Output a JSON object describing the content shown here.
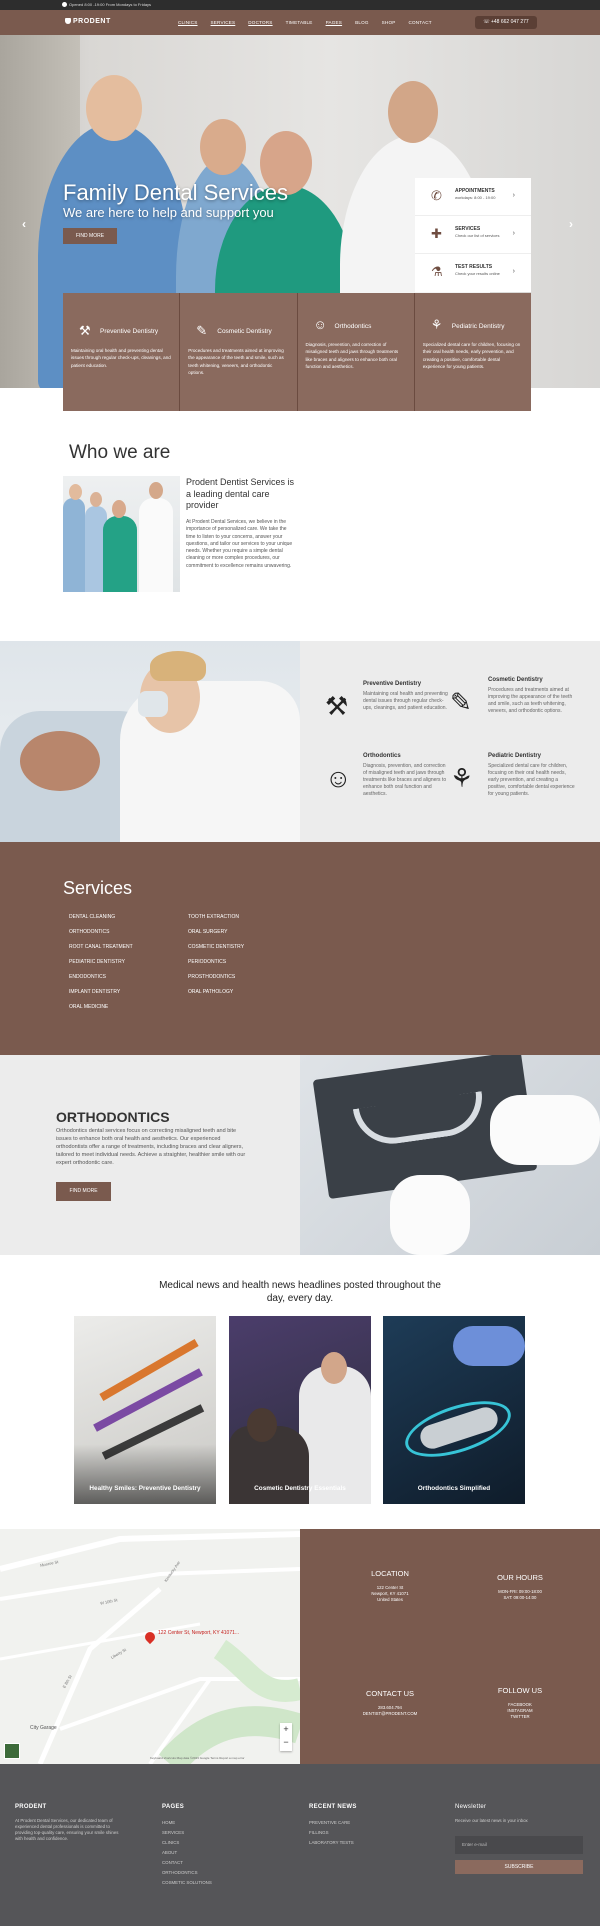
{
  "topbar": {
    "hours": "Opened 8:00 -19:00 From Mondays to Fridays"
  },
  "nav": {
    "logo": "PRODENT",
    "items": [
      "CLINICS",
      "SERVICES",
      "DOCTORS",
      "TIMETABLE",
      "PAGES",
      "BLOG",
      "SHOP",
      "CONTACT"
    ],
    "phone": "+48 662 047 277"
  },
  "hero": {
    "title": "Family Dental Services",
    "subtitle": "We are here to help and support you",
    "button": "FIND MORE"
  },
  "side": [
    {
      "title": "APPOINTMENTS",
      "sub": "workdays: 8:00 - 19:00",
      "icon": "phone-icon"
    },
    {
      "title": "SERVICES",
      "sub": "Check our list of services",
      "icon": "medkit-icon"
    },
    {
      "title": "TEST RESULTS",
      "sub": "Check your results online",
      "icon": "microscope-icon"
    }
  ],
  "cards": [
    {
      "title": "Preventive Dentistry",
      "desc": "Maintaining oral health and preventing dental issues through regular check-ups, cleanings, and patient education."
    },
    {
      "title": "Cosmetic Dentistry",
      "desc": "Procedures and treatments aimed at improving the appearance of the teeth and smile, such as teeth whitening, veneers, and orthodontic options."
    },
    {
      "title": "Orthodontics",
      "desc": "Diagnosis, prevention, and correction of misaligned teeth and jaws through treatments like braces and aligners to enhance both oral function and aesthetics."
    },
    {
      "title": "Pediatric Dentistry",
      "desc": "Specialized dental care for children, focusing on their oral health needs, early prevention, and creating a positive, comfortable dental experience for young patients."
    }
  ],
  "who": {
    "heading": "Who we are",
    "title": "Prodent Dentist Services is a leading dental care provider",
    "text": "At Prodent Dental Services, we believe in the importance of personalized care. We take the time to listen to your concerns, answer your questions, and tailor our services to your unique needs. Whether you require a simple dental cleaning or more complex procedures, our commitment to excellence remains unwavering."
  },
  "services": {
    "heading": "Services",
    "col1": [
      "DENTAL CLEANING",
      "ORTHODONTICS",
      "ROOT CANAL TREATMENT",
      "PEDIATRIC DENTISTRY",
      "ENDODONTICS",
      "IMPLANT DENTISTRY",
      "ORAL MEDICINE"
    ],
    "col2": [
      "TOOTH EXTRACTION",
      "ORAL SURGERY",
      "COSMETIC DENTISTRY",
      "PERIODONTICS",
      "PROSTHODONTICS",
      "ORAL PATHOLOGY"
    ]
  },
  "ortho": {
    "title": "ORTHODONTICS",
    "text": "Orthodontics dental services focus on correcting misaligned teeth and bite issues to enhance both oral health and aesthetics. Our experienced orthodontists offer a range of treatments, including braces and clear aligners, tailored to meet individual needs. Achieve a straighter, healthier smile with our expert orthodontic care.",
    "button": "FIND MORE"
  },
  "news": {
    "heading": "Medical news and health news headlines posted throughout the day, every day.",
    "items": [
      "Healthy Smiles: Preventive Dentistry",
      "Cosmetic Dentistry Essentials",
      "Orthodontics Simplified"
    ]
  },
  "map": {
    "label": "122 Center St, Newport, KY 41071...",
    "city": "City Garage",
    "streets": [
      "Monroe St",
      "W 10th St",
      "Liberty St",
      "E 8th St",
      "Kentucky Ave"
    ],
    "attrib": "Keyboard shortcuts   Map data ©2023 Google   Terms   Report a map error"
  },
  "contact": {
    "location": {
      "h": "LOCATION",
      "lines": [
        "122 Center St",
        "Newport, KY 41071",
        "United States"
      ]
    },
    "hours": {
      "h": "OUR HOURS",
      "lines": [
        "MON-FRI: 09:00-18:00",
        "SAT: 09:00-14:00"
      ]
    },
    "contact": {
      "h": "CONTACT US",
      "lines": [
        "283.604.794",
        "DENTIST@PRODENT.COM"
      ]
    },
    "follow": {
      "h": "FOLLOW US",
      "lines": [
        "FACEBOOK",
        "INSTAGRAM",
        "TWITTER"
      ]
    }
  },
  "footer": {
    "brand": "PRODENT",
    "about": "At Prodent Dental Services, our dedicated team of experienced dental professionals is committed to providing top-quality care, ensuring your smile shines with health and confidence.",
    "pages_h": "PAGES",
    "pages": [
      "HOME",
      "SERVICES",
      "CLINICS",
      "ABOUT",
      "CONTACT",
      "ORTHODONTICS",
      "COSMETIC SOLUTIONS"
    ],
    "news_h": "RECENT NEWS",
    "news": [
      "PREVENTIVE CARE",
      "FILLINGS",
      "LABORATORY TESTS"
    ],
    "newsletter_h": "Newsletter",
    "newsletter_p": "Receive our latest news in your inbox",
    "email_placeholder": "Enter e-mail",
    "subscribe": "SUBSCRIBE"
  },
  "colors": {
    "brand": "#7a5a4e",
    "dark": "#5b3f35",
    "footer": "#555558"
  }
}
